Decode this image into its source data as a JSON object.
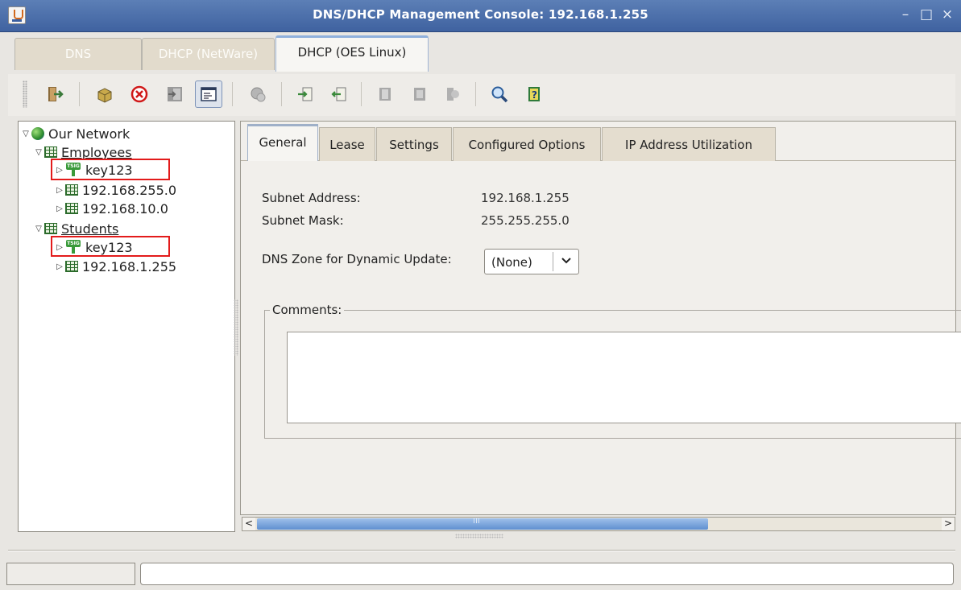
{
  "window": {
    "title": "DNS/DHCP Management Console: 192.168.1.255",
    "minimize": "–",
    "maximize": "□",
    "close": "×"
  },
  "main_tabs": [
    {
      "label": "DNS",
      "active": false
    },
    {
      "label": "DHCP (NetWare)",
      "active": false
    },
    {
      "label": "DHCP (OES Linux)",
      "active": true
    }
  ],
  "toolbar": {
    "icons": [
      "exit-icon",
      "create-object-icon",
      "delete-icon",
      "import-icon",
      "properties-icon",
      "service-icon",
      "import-config-icon",
      "export-config-icon",
      "start-service-icon",
      "stop-service-icon",
      "audit-icon",
      "search-icon",
      "help-icon"
    ],
    "pressed": "properties-icon"
  },
  "tree": {
    "root": "Our Network",
    "items": [
      {
        "label": "Employees",
        "type": "group",
        "expanded": true,
        "depth": 1
      },
      {
        "label": "key123",
        "type": "tsig",
        "depth": 2,
        "highlighted": true
      },
      {
        "label": "192.168.255.0",
        "type": "subnet",
        "depth": 2
      },
      {
        "label": "192.168.10.0",
        "type": "subnet",
        "depth": 2
      },
      {
        "label": "Students",
        "type": "group",
        "expanded": true,
        "depth": 1
      },
      {
        "label": "key123",
        "type": "tsig",
        "depth": 2,
        "highlighted": true
      },
      {
        "label": "192.168.1.255",
        "type": "subnet",
        "depth": 2
      }
    ]
  },
  "detail_tabs": [
    {
      "label": "General",
      "active": true
    },
    {
      "label": "Lease",
      "active": false
    },
    {
      "label": "Settings",
      "active": false
    },
    {
      "label": "Configured Options",
      "active": false
    },
    {
      "label": "IP Address Utilization",
      "active": false
    }
  ],
  "general": {
    "subnet_address_label": "Subnet Address:",
    "subnet_address": "192.168.1.255",
    "subnet_mask_label": "Subnet Mask:",
    "subnet_mask": "255.255.255.0",
    "dns_zone_label": "DNS Zone for Dynamic Update:",
    "dns_zone_value": "(None)",
    "comments_label": "Comments:",
    "comments_value": ""
  },
  "scroll": {
    "left": "<",
    "right": ">",
    "grip": "III"
  },
  "colors": {
    "titlebar": "#4a6ea8",
    "highlight_box": "#e31b1b",
    "tsig_green": "#3a9a3a"
  }
}
